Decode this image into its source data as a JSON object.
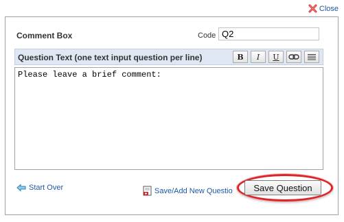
{
  "close": {
    "label": "Close",
    "icon": "close-x-icon"
  },
  "dialog": {
    "title": "Comment Box",
    "code_label": "Code :",
    "code_value": "Q2",
    "question_header": "Question Text (one text input question per line)",
    "format_buttons": [
      {
        "name": "bold",
        "label": "B"
      },
      {
        "name": "italic",
        "label": "I"
      },
      {
        "name": "underline",
        "label": "U"
      },
      {
        "name": "link",
        "icon": "link-icon"
      },
      {
        "name": "align",
        "icon": "align-justify-icon"
      }
    ],
    "question_text": "Please leave a brief comment:"
  },
  "footer": {
    "start_over": "Start Over",
    "save_add_new": "Save/Add New Questio",
    "save_question": "Save Question"
  },
  "colors": {
    "link": "#1f57a4",
    "header_bg": "#dfe7f4",
    "highlight_oval": "#d9262a",
    "close_icon": "#d62d2d"
  }
}
